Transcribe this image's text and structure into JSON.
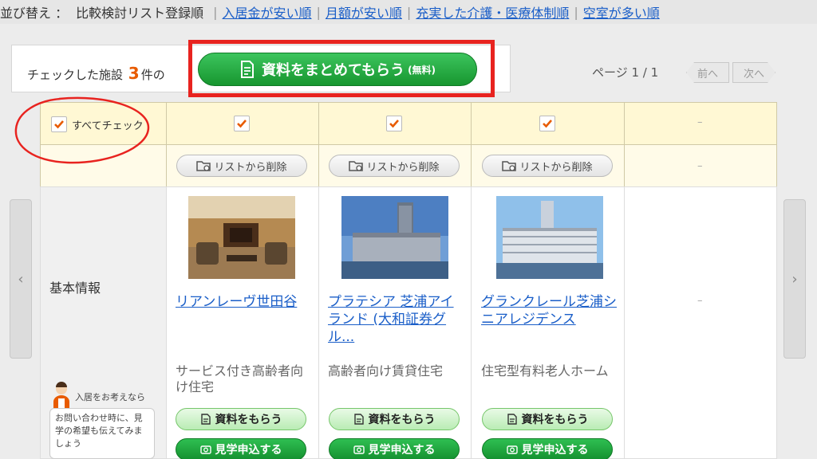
{
  "sort": {
    "label": "並び替え ：",
    "current": "比較検討リスト登録順",
    "options": [
      "入居金が安い順",
      "月額が安い順",
      "充実した介護・医療体制順",
      "空室が多い順"
    ]
  },
  "summary": {
    "prefix": "チェックした施設",
    "count": "3",
    "suffix": "件の"
  },
  "cta": {
    "label": "資料をまとめてもらう",
    "note": "(無料)"
  },
  "pager": {
    "label": "ページ 1 / 1",
    "prev": "前へ",
    "next": "次へ"
  },
  "table": {
    "check_all": "すべてチェック",
    "remove_label": "リストから削除",
    "dash": "–",
    "basic_info": "基本情報"
  },
  "facilities": [
    {
      "name": "リアンレーヴ世田谷",
      "type": "サービス付き高齢者向け住宅",
      "checked": true
    },
    {
      "name": "プラテシア 芝浦アイランド (大和証券グル...",
      "type": "高齢者向け賃貸住宅",
      "checked": true
    },
    {
      "name": "グランクレール芝浦シニアレジデンス",
      "type": "住宅型有料老人ホーム",
      "checked": true
    }
  ],
  "actions": {
    "request_docs": "資料をもらう",
    "visit": "見学申込する"
  },
  "advice": {
    "title": "入居をお考えなら",
    "body": "お問い合わせ時に、見学の希望も伝えてみましょう"
  },
  "colors": {
    "accent": "#e85b00",
    "link": "#1a5ec8",
    "green": "#17962f",
    "highlight": "#e8231f"
  }
}
